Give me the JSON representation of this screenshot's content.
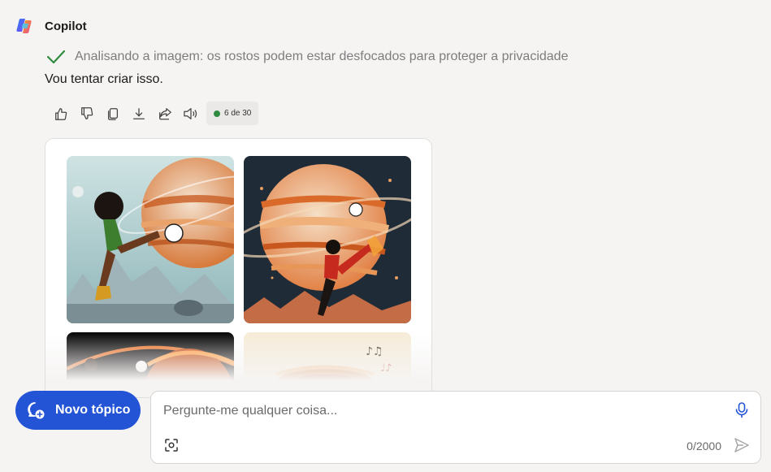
{
  "app": {
    "name": "Copilot"
  },
  "message": {
    "status": "Analisando a imagem: os rostos podem estar desfocados para proteger a privacidade",
    "reply": "Vou tentar criar isso.",
    "counter": "6 de 30"
  },
  "actions": [
    {
      "icon": "thumbs-up-icon"
    },
    {
      "icon": "thumbs-down-icon"
    },
    {
      "icon": "copy-icon"
    },
    {
      "icon": "download-icon"
    },
    {
      "icon": "share-icon"
    },
    {
      "icon": "speaker-icon"
    }
  ],
  "images": [
    {
      "subject": "soccer-player-jupiter-1"
    },
    {
      "subject": "soccer-player-jupiter-2"
    },
    {
      "subject": "soccer-player-jupiter-3"
    },
    {
      "subject": "soccer-player-jupiter-4"
    }
  ],
  "new_topic": {
    "label": "Novo tópico"
  },
  "composer": {
    "placeholder": "Pergunte-me qualquer coisa...",
    "char_count": "0/2000"
  },
  "colors": {
    "accent": "#2354d6",
    "success": "#2e8b40",
    "background": "#f6f4f3"
  }
}
